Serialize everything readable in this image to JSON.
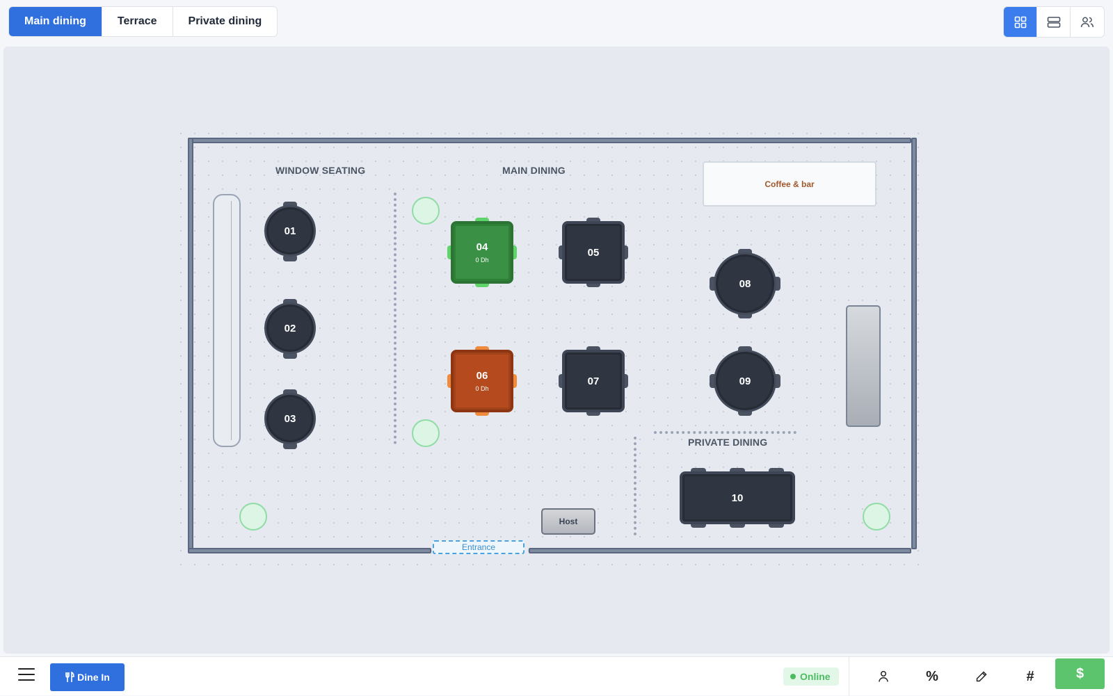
{
  "tabs": [
    {
      "label": "Main dining",
      "active": true
    },
    {
      "label": "Terrace",
      "active": false
    },
    {
      "label": "Private dining",
      "active": false
    }
  ],
  "view_buttons": [
    {
      "icon": "grid-view-icon",
      "active": true
    },
    {
      "icon": "list-view-icon",
      "active": false
    },
    {
      "icon": "users-icon",
      "active": false
    }
  ],
  "floor": {
    "zones": {
      "window_seating": "WINDOW SEATING",
      "main_dining": "MAIN DINING",
      "private_dining": "PRIVATE DINING"
    },
    "bar_label": "Coffee & bar",
    "host_label": "Host",
    "entrance_label": "Entrance",
    "tables": [
      {
        "id": "01",
        "shape": "round",
        "status": "free"
      },
      {
        "id": "02",
        "shape": "round",
        "status": "free"
      },
      {
        "id": "03",
        "shape": "round",
        "status": "free"
      },
      {
        "id": "04",
        "shape": "square",
        "status": "occupied-green",
        "amount": "0 Dh"
      },
      {
        "id": "05",
        "shape": "square",
        "status": "free"
      },
      {
        "id": "06",
        "shape": "square",
        "status": "occupied-orange",
        "amount": "0 Dh"
      },
      {
        "id": "07",
        "shape": "square",
        "status": "free"
      },
      {
        "id": "08",
        "shape": "round",
        "status": "free"
      },
      {
        "id": "09",
        "shape": "round",
        "status": "free"
      },
      {
        "id": "10",
        "shape": "long",
        "status": "free"
      }
    ]
  },
  "bottom": {
    "dine_in_label": "Dine In",
    "status_label": "Online",
    "actions": [
      {
        "icon": "person-icon"
      },
      {
        "icon": "percent-icon",
        "glyph": "%"
      },
      {
        "icon": "pencil-icon"
      },
      {
        "icon": "hash-icon",
        "glyph": "#"
      },
      {
        "icon": "dollar-icon",
        "glyph": "$"
      }
    ]
  },
  "colors": {
    "accent": "#2f6fde",
    "occupied_green": "#3a9044",
    "occupied_orange": "#b44a1e",
    "online": "#4cbb62",
    "pay": "#5bc46d"
  }
}
